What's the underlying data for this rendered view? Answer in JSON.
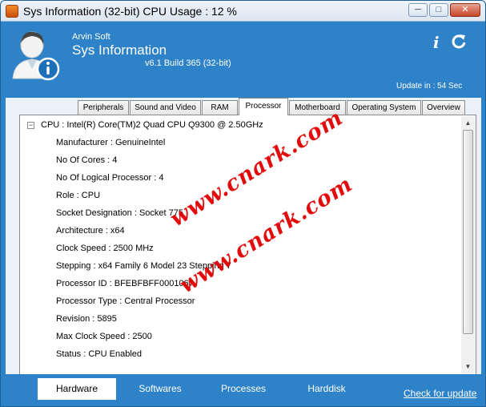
{
  "window": {
    "title": "Sys Information (32-bit) CPU Usage : 12 %",
    "minimize_glyph": "─",
    "maximize_glyph": "□",
    "close_glyph": "✕"
  },
  "header": {
    "brand": "Arvin Soft",
    "app_name": "Sys Information",
    "version": "v6.1 Build 365 (32-bit)",
    "info_glyph": "i",
    "update_text": "Update in : 54 Sec"
  },
  "tabs": [
    {
      "label": "Peripherals",
      "active": false
    },
    {
      "label": "Sound and Video",
      "active": false
    },
    {
      "label": "RAM",
      "active": false
    },
    {
      "label": "Processor",
      "active": true
    },
    {
      "label": "Motherboard",
      "active": false
    },
    {
      "label": "Operating System",
      "active": false
    },
    {
      "label": "Overview",
      "active": false
    }
  ],
  "processor": {
    "toggle": "−",
    "root": "CPU : Intel(R) Core(TM)2 Quad  CPU   Q9300  @ 2.50GHz",
    "items": [
      "Manufacturer : GenuineIntel",
      "No Of Cores : 4",
      "No Of Logical Processor : 4",
      "Role : CPU",
      "Socket Designation : Socket 775",
      "Architecture : x64",
      "Clock Speed : 2500 MHz",
      "Stepping : x64 Family 6 Model 23 Stepping 7",
      "Processor ID : BFEBFBFF0001067",
      "Processor Type : Central Processor",
      "Revision : 5895",
      "Max Clock Speed : 2500",
      "Status : CPU Enabled"
    ]
  },
  "scrollbar": {
    "up_glyph": "▲",
    "down_glyph": "▼"
  },
  "bottom_tabs": [
    {
      "label": "Hardware",
      "active": true
    },
    {
      "label": "Softwares",
      "active": false
    },
    {
      "label": "Processes",
      "active": false
    },
    {
      "label": "Harddisk",
      "active": false
    }
  ],
  "check_update": "Check for update",
  "watermarks": [
    "www.cnark.com",
    "www.cnark.com"
  ],
  "colors": {
    "header_blue": "#2e82c8",
    "watermark_red": "#e10000"
  }
}
